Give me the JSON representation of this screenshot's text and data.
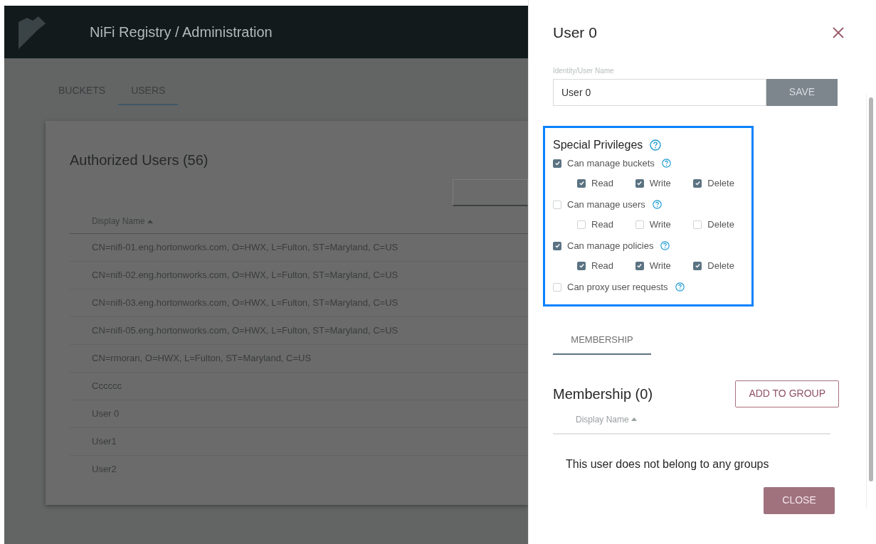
{
  "header": {
    "title": "NiFi Registry / Administration"
  },
  "tabs": [
    {
      "label": "BUCKETS",
      "selected": false
    },
    {
      "label": "USERS",
      "selected": true
    }
  ],
  "users_table": {
    "title": "Authorized Users (56)",
    "column": "Display Name",
    "rows": [
      "CN=nifi-01.eng.hortonworks.com, O=HWX, L=Fulton, ST=Maryland, C=US",
      "CN=nifi-02.eng.hortonworks.com, O=HWX, L=Fulton, ST=Maryland, C=US",
      "CN=nifi-03.eng.hortonworks.com, O=HWX, L=Fulton, ST=Maryland, C=US",
      "CN=nifi-05.eng.hortonworks.com, O=HWX, L=Fulton, ST=Maryland, C=US",
      "CN=rmoran, O=HWX, L=Fulton, ST=Maryland, C=US",
      "Cccccc",
      "User 0",
      "User1",
      "User2"
    ]
  },
  "user_panel": {
    "title": "User 0",
    "identity_label": "Identity/User Name",
    "identity_value": "User 0",
    "save": "SAVE",
    "privileges": {
      "title": "Special Privileges",
      "items": [
        {
          "label": "Can manage buckets",
          "checked": true,
          "permissions": [
            {
              "label": "Read",
              "checked": true
            },
            {
              "label": "Write",
              "checked": true
            },
            {
              "label": "Delete",
              "checked": true
            }
          ]
        },
        {
          "label": "Can manage users",
          "checked": false,
          "permissions": [
            {
              "label": "Read",
              "checked": false
            },
            {
              "label": "Write",
              "checked": false
            },
            {
              "label": "Delete",
              "checked": false
            }
          ]
        },
        {
          "label": "Can manage policies",
          "checked": true,
          "permissions": [
            {
              "label": "Read",
              "checked": true
            },
            {
              "label": "Write",
              "checked": true
            },
            {
              "label": "Delete",
              "checked": true
            }
          ]
        },
        {
          "label": "Can proxy user requests",
          "checked": false
        }
      ]
    },
    "tabs": [
      {
        "label": "MEMBERSHIP",
        "selected": true
      }
    ],
    "membership": {
      "title": "Membership (0)",
      "add_button": "ADD TO GROUP",
      "column": "Display Name",
      "empty_message": "This user does not belong to any groups"
    },
    "close": "CLOSE"
  }
}
